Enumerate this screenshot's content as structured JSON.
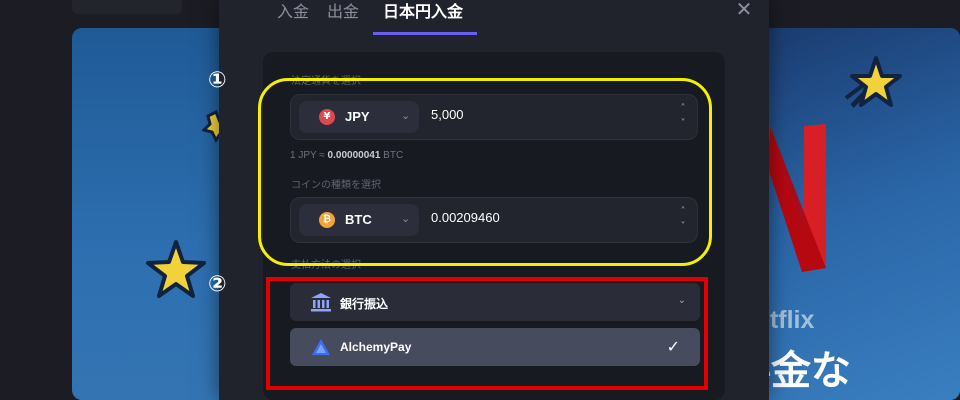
{
  "modal": {
    "tabs": [
      {
        "label": "入金"
      },
      {
        "label": "出金"
      },
      {
        "label": "日本円入金"
      }
    ],
    "active_tab": "日本円入金",
    "close_icon": "close-icon"
  },
  "fiat": {
    "section_label": "法定通貨を選択",
    "currency_code": "JPY",
    "currency_symbol": "¥",
    "amount": "5,000"
  },
  "rate": {
    "prefix": "1 JPY ≈ ",
    "value": "0.00000041",
    "suffix": " BTC"
  },
  "crypto": {
    "section_label": "コインの種類を選択",
    "currency_code": "BTC",
    "currency_symbol": "₿",
    "amount": "0.00209460"
  },
  "payment": {
    "section_label": "支払方法の選択",
    "methods": [
      {
        "label": "銀行振込",
        "icon": "bank-icon",
        "selected": false
      },
      {
        "label": "AlchemyPay",
        "icon": "alchemypay-icon",
        "selected": true
      }
    ]
  },
  "annotations": {
    "marker_1": "①",
    "marker_2": "②",
    "highlight_color_1": "#f4f000",
    "highlight_color_2": "#e00000"
  },
  "background": {
    "brand": "Netflix",
    "banner_text": "Jの料金な"
  }
}
